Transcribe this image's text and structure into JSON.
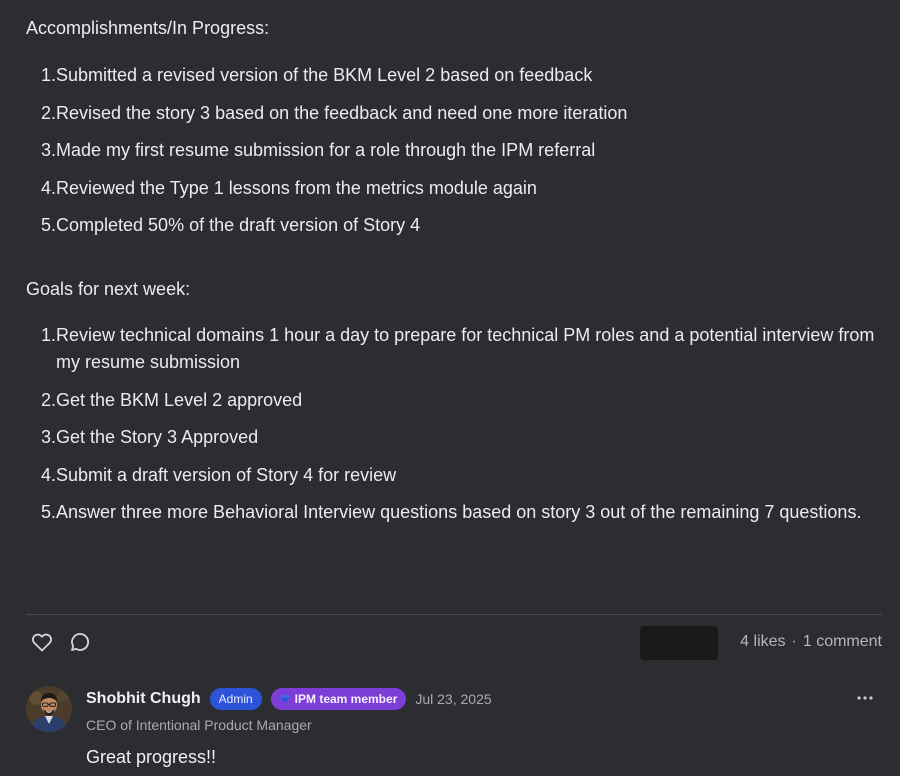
{
  "post": {
    "accomplishments_heading": "Accomplishments/In Progress:",
    "accomplishments": [
      {
        "num": "1.",
        "text": "Submitted a revised version of the BKM Level 2 based on feedback"
      },
      {
        "num": "2.",
        "text": "Revised the story 3 based on the feedback and need one more iteration"
      },
      {
        "num": "3.",
        "text": "Made my first resume submission for a role through the IPM referral"
      },
      {
        "num": "4.",
        "text": "Reviewed the Type 1 lessons from the metrics module again"
      },
      {
        "num": "5.",
        "text": "Completed 50% of the draft version of Story 4"
      }
    ],
    "goals_heading": "Goals for next week:",
    "goals": [
      {
        "num": "1.",
        "text": "Review technical domains 1 hour a day to prepare for technical PM roles and a potential interview from my resume submission"
      },
      {
        "num": "2.",
        "text": "Get the BKM Level 2 approved"
      },
      {
        "num": "3.",
        "text": "Get the Story 3 Approved"
      },
      {
        "num": "4.",
        "text": "Submit a draft version of Story 4 for review"
      },
      {
        "num": "5.",
        "text": "Answer three more Behavioral Interview questions based on story 3 out of the remaining  7 questions."
      }
    ]
  },
  "actions": {
    "like_icon": "heart-outline",
    "comment_icon": "speech-bubble-outline",
    "likes": "4 likes",
    "separator": "·",
    "comments": "1 comment"
  },
  "comment": {
    "author": "Shobhit Chugh",
    "badge_admin": "Admin",
    "badge_team": "IPM team member",
    "badge_team_icon": "diamond-gem",
    "date": "Jul 23, 2025",
    "author_title": "CEO of Intentional Product Manager",
    "body": "Great progress!!",
    "more_icon": "ellipsis-horizontal"
  },
  "colors": {
    "background": "#2b2d31",
    "admin_badge": "#2d54d8",
    "team_badge": "#7c3ed6",
    "muted_text": "#a9aaaf"
  }
}
